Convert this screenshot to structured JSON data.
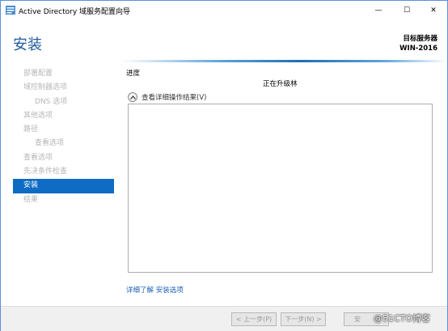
{
  "window": {
    "title": "Active Directory 域服务配置向导",
    "minimize_glyph": "—",
    "maximize_glyph": "☐",
    "close_glyph": "✕"
  },
  "header": {
    "page_heading": "安装",
    "server_label": "目标服务器",
    "server_name": "WIN-2016"
  },
  "nav": {
    "items": [
      {
        "label": "部署配置"
      },
      {
        "label": "域控制器选项"
      },
      {
        "label": "DNS 选项"
      },
      {
        "label": "其他选项"
      },
      {
        "label": "路径"
      },
      {
        "label": "查看选项"
      },
      {
        "label": "查看选项"
      },
      {
        "label": "先决条件检查"
      },
      {
        "label": "安装"
      },
      {
        "label": "结果"
      }
    ]
  },
  "main": {
    "section_title": "进度",
    "status_text": "正在升级林",
    "expand_label": "查看详细操作结果(V)",
    "more_links": "详细了解 安装选项"
  },
  "footer": {
    "prev_label": "< 上一步(P)",
    "next_label": "下一步(N) >",
    "install_label": "安"
  },
  "watermark": "@51CTO博客",
  "colors": {
    "accent": "#0e6cc4",
    "heading": "#1f5b9a",
    "link": "#1a5fb4"
  },
  "icons": [
    "ad-wizard-icon",
    "chevron-up-icon"
  ]
}
